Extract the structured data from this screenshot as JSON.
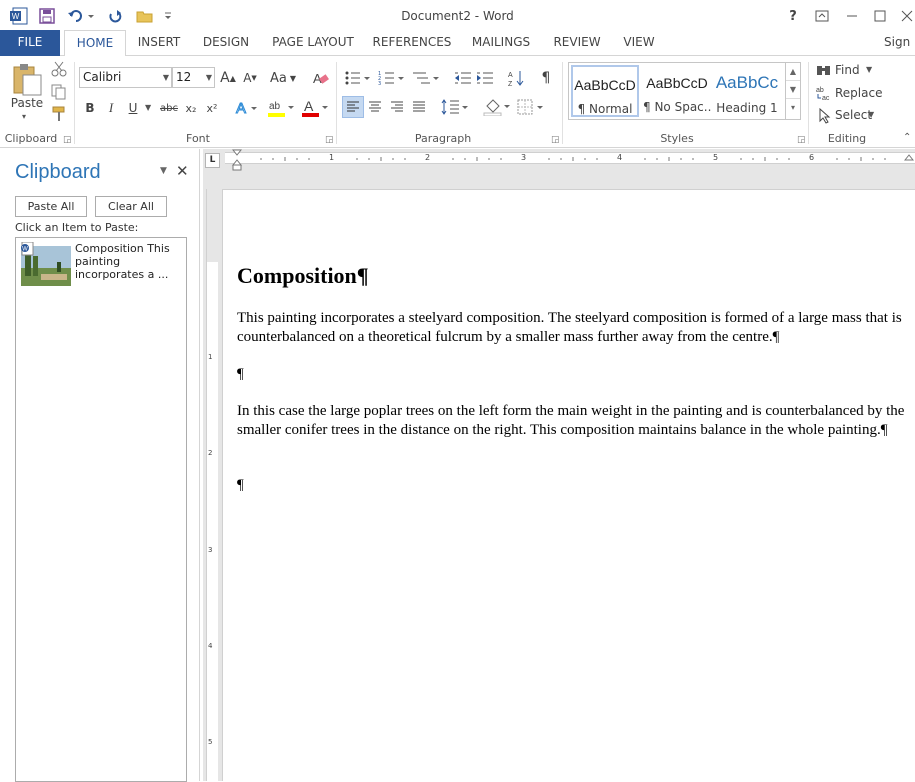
{
  "window": {
    "title": "Document2 - Word",
    "help": "?",
    "sign_in": "Sign"
  },
  "tabs": [
    {
      "label": "FILE"
    },
    {
      "label": "HOME"
    },
    {
      "label": "INSERT"
    },
    {
      "label": "DESIGN"
    },
    {
      "label": "PAGE LAYOUT"
    },
    {
      "label": "REFERENCES"
    },
    {
      "label": "MAILINGS"
    },
    {
      "label": "REVIEW"
    },
    {
      "label": "VIEW"
    }
  ],
  "ribbon": {
    "clipboard": {
      "label": "Clipboard",
      "paste": "Paste"
    },
    "font": {
      "label": "Font",
      "name": "Calibri",
      "size": "12",
      "bold": "B",
      "italic": "I",
      "underline": "U",
      "strike": "abc",
      "sub": "x₂",
      "sup": "x²",
      "grow": "A",
      "shrink": "A",
      "case": "Aa",
      "highlight": "ab",
      "color": "A"
    },
    "paragraph": {
      "label": "Paragraph",
      "pilcrow": "¶"
    },
    "styles": {
      "label": "Styles",
      "items": [
        {
          "preview": "AaBbCcD",
          "name": "¶ Normal"
        },
        {
          "preview": "AaBbCcD",
          "name": "¶ No Spac..."
        },
        {
          "preview": "AaBbCc",
          "name": "Heading 1"
        }
      ]
    },
    "editing": {
      "label": "Editing",
      "find": "Find",
      "replace": "Replace",
      "select": "Select"
    }
  },
  "clipboard_pane": {
    "title": "Clipboard",
    "paste_all": "Paste All",
    "clear_all": "Clear All",
    "instruction": "Click an Item to Paste:",
    "items": [
      {
        "text": "Composition This painting incorporates a ..."
      }
    ]
  },
  "ruler": {
    "h_numbers": [
      "1",
      "2",
      "3",
      "4",
      "5",
      "6"
    ],
    "v_numbers": [
      "1",
      "2",
      "3",
      "4",
      "5"
    ]
  },
  "document": {
    "heading": "Composition¶",
    "p1": "This painting incorporates a steelyard composition. The steelyard composition is formed of a large mass that is counterbalanced on a theoretical fulcrum by a smaller mass further away from the centre.¶",
    "p2": "¶",
    "p3": "In this case the large poplar trees on the left form the main weight in the painting and is counterbalanced by the smaller conifer trees in the distance on the right. This composition maintains balance in the whole painting.¶",
    "p4": "¶"
  },
  "colors": {
    "accent": "#2b579a",
    "pane_title": "#2e75b6"
  }
}
